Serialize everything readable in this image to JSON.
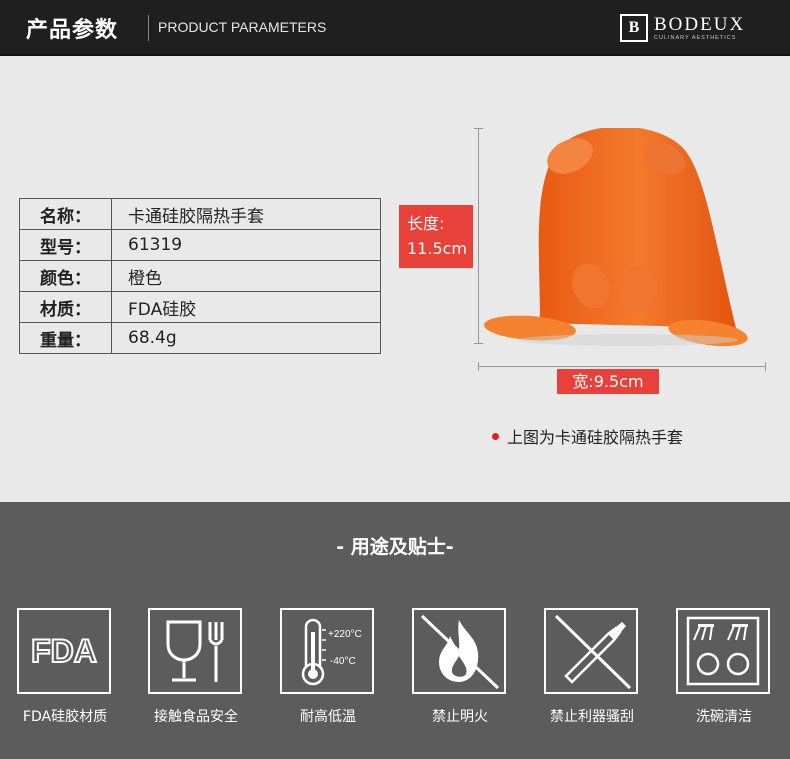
{
  "header": {
    "title_cn": "产品参数",
    "title_en": "PRODUCT PARAMETERS",
    "brand_logo": "B",
    "brand_name": "BODEUX",
    "brand_sub": "CULINARY AESTHETICS"
  },
  "params": [
    {
      "key": "名称：",
      "value": "卡通硅胶隔热手套"
    },
    {
      "key": "型号：",
      "value": "61319"
    },
    {
      "key": "颜色：",
      "value": "橙色"
    },
    {
      "key": "材质：",
      "value": "FDA硅胶"
    },
    {
      "key": "重量：",
      "value": "68.4g"
    }
  ],
  "product": {
    "length_label_line1": "长度:",
    "length_label_line2": "11.5cm",
    "width_label": "宽:9.5cm",
    "caption": "上图为卡通硅胶隔热手套",
    "color": "#f26a1f",
    "accent_color": "#e8413a"
  },
  "usage": {
    "title": "- 用途及贴士-",
    "icons": [
      {
        "name": "fda-icon",
        "text": "FDA",
        "label": "FDA硅胶材质"
      },
      {
        "name": "food-safe-icon",
        "label": "接触食品安全"
      },
      {
        "name": "thermometer-icon",
        "temp_high": "+220°C",
        "temp_low": "-40°C",
        "label": "耐高低温"
      },
      {
        "name": "no-fire-icon",
        "label": "禁止明火"
      },
      {
        "name": "no-knife-icon",
        "label": "禁止利器骚刮"
      },
      {
        "name": "dishwasher-icon",
        "label": "洗碗清洁"
      }
    ]
  }
}
